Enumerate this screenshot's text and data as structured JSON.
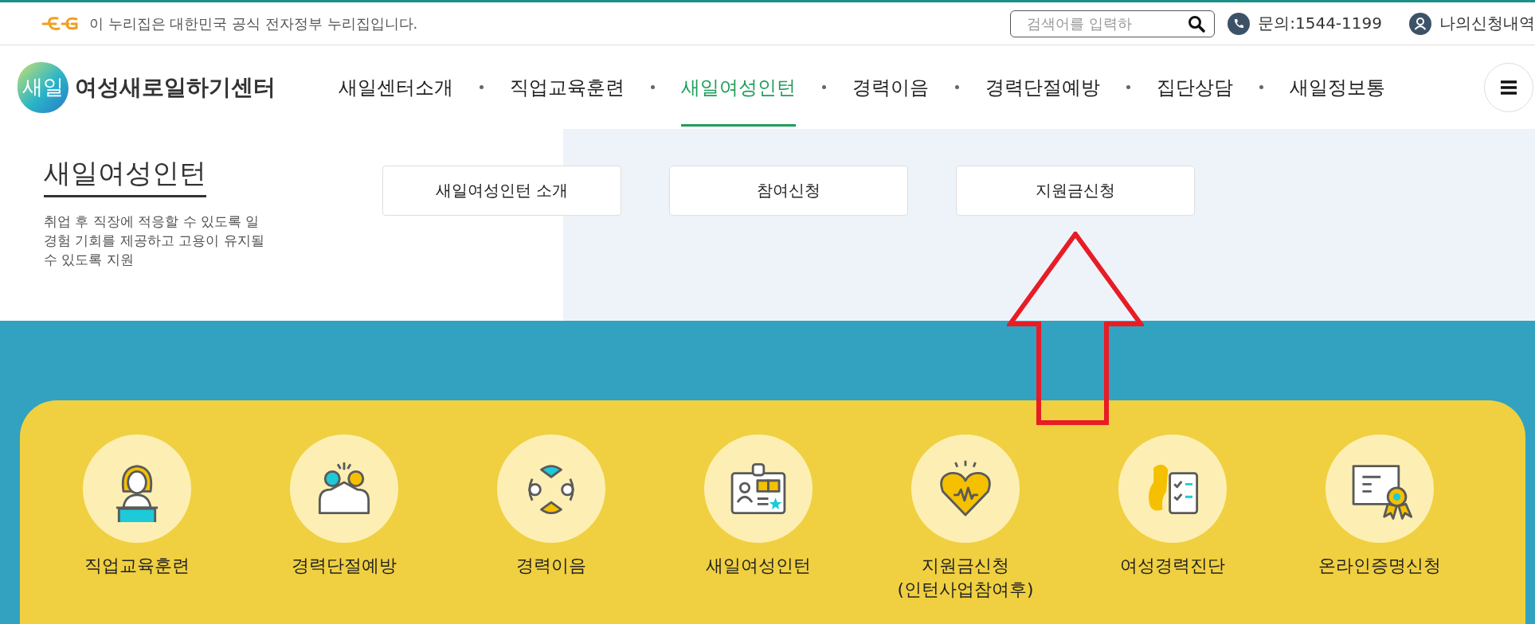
{
  "top_bar": {
    "notice": "이 누리집은 대한민국 공식 전자정부 누리집입니다.",
    "search": {
      "placeholder": "검색어를 입력하"
    },
    "contact": "문의:1544-1199",
    "my_applications": "나의신청내역"
  },
  "header": {
    "logo": {
      "mark": "새일",
      "name": "여성새로일하기센터"
    },
    "nav": [
      {
        "label": "새일센터소개",
        "selected": false
      },
      {
        "label": "직업교육훈련",
        "selected": false
      },
      {
        "label": "새일여성인턴",
        "selected": true
      },
      {
        "label": "경력이음",
        "selected": false
      },
      {
        "label": "경력단절예방",
        "selected": false
      },
      {
        "label": "집단상담",
        "selected": false
      },
      {
        "label": "새일정보통",
        "selected": false
      }
    ]
  },
  "dropdown": {
    "title": "새일여성인턴",
    "description": "취업 후 직장에 적응할 수 있도록 일경험 기회를 제공하고 고용이 유지될 수 있도록 지원",
    "links": [
      "새일여성인턴 소개",
      "참여신청",
      "지원금신청"
    ]
  },
  "quick_menu": [
    {
      "lines": [
        "직업교육훈련"
      ]
    },
    {
      "lines": [
        "경력단절예방"
      ]
    },
    {
      "lines": [
        "경력이음"
      ]
    },
    {
      "lines": [
        "새일여성인턴"
      ]
    },
    {
      "lines": [
        "지원금신청",
        "(인턴사업참여후)"
      ]
    },
    {
      "lines": [
        "여성경력진단"
      ]
    },
    {
      "lines": [
        "온라인증명신청"
      ]
    }
  ]
}
